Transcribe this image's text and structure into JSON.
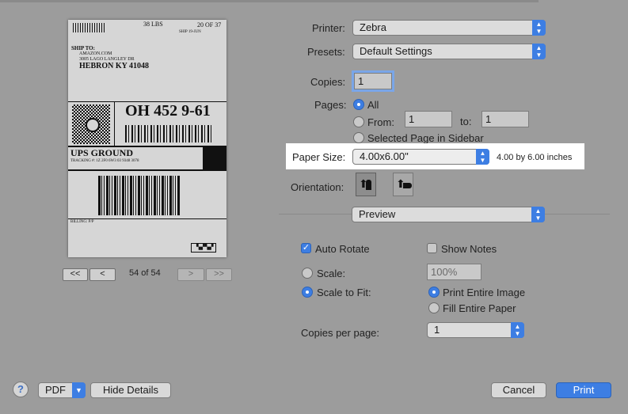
{
  "label_preview": {
    "weight": "38 LBS",
    "page_of": "20 OF 37",
    "ship_date": "SHIP 19-JUN",
    "ship_to_label": "SHIP TO:",
    "ship_to_line1": "AMAZON.COM",
    "ship_to_line2": "3005 LAGO LANGLEY DR",
    "ship_to_city": "HEBRON   KY 41048",
    "route_code": "OH 452 9-61",
    "service": "UPS GROUND",
    "tracking": "TRACKING #: 1Z 2F0 6W3 03 9348 3078",
    "billing": "BILLING: P/P",
    "footer_code": "▚▞▚▞"
  },
  "pager": {
    "first_label": "<<",
    "prev_label": "<",
    "page_text": "54 of 54",
    "next_label": ">",
    "last_label": ">>"
  },
  "printer": {
    "label": "Printer:",
    "value": "Zebra"
  },
  "presets": {
    "label": "Presets:",
    "value": "Default Settings"
  },
  "copies": {
    "label": "Copies:",
    "value": "1"
  },
  "pages": {
    "label": "Pages:",
    "all_label": "All",
    "from_label": "From:",
    "from_value": "1",
    "to_label": "to:",
    "to_value": "1",
    "selected_label": "Selected Page in Sidebar"
  },
  "paper_size": {
    "label": "Paper Size:",
    "value": "4.00x6.00\"",
    "description": "4.00 by 6.00 inches"
  },
  "orientation": {
    "label": "Orientation:"
  },
  "section_popup": {
    "value": "Preview"
  },
  "auto_rotate": {
    "label": "Auto Rotate",
    "checked": true
  },
  "show_notes": {
    "label": "Show Notes",
    "checked": false
  },
  "scale": {
    "label": "Scale:",
    "value": "100%"
  },
  "scale_to_fit": {
    "label": "Scale to Fit:"
  },
  "print_entire_image": {
    "label": "Print Entire Image"
  },
  "fill_entire_paper": {
    "label": "Fill Entire Paper"
  },
  "copies_per_page": {
    "label": "Copies per page:",
    "value": "1"
  },
  "footer": {
    "help_label": "?",
    "pdf_label": "PDF",
    "hide_details_label": "Hide Details",
    "cancel_label": "Cancel",
    "print_label": "Print"
  },
  "colors": {
    "accent": "#3d7ee3",
    "highlight": "#ffffff",
    "dialog_bg": "#9c9c9c"
  },
  "icons": {
    "stepper": "up-down-arrows-icon",
    "portrait": "portrait-person-icon",
    "landscape": "landscape-person-icon",
    "check": "checkmark-icon"
  }
}
